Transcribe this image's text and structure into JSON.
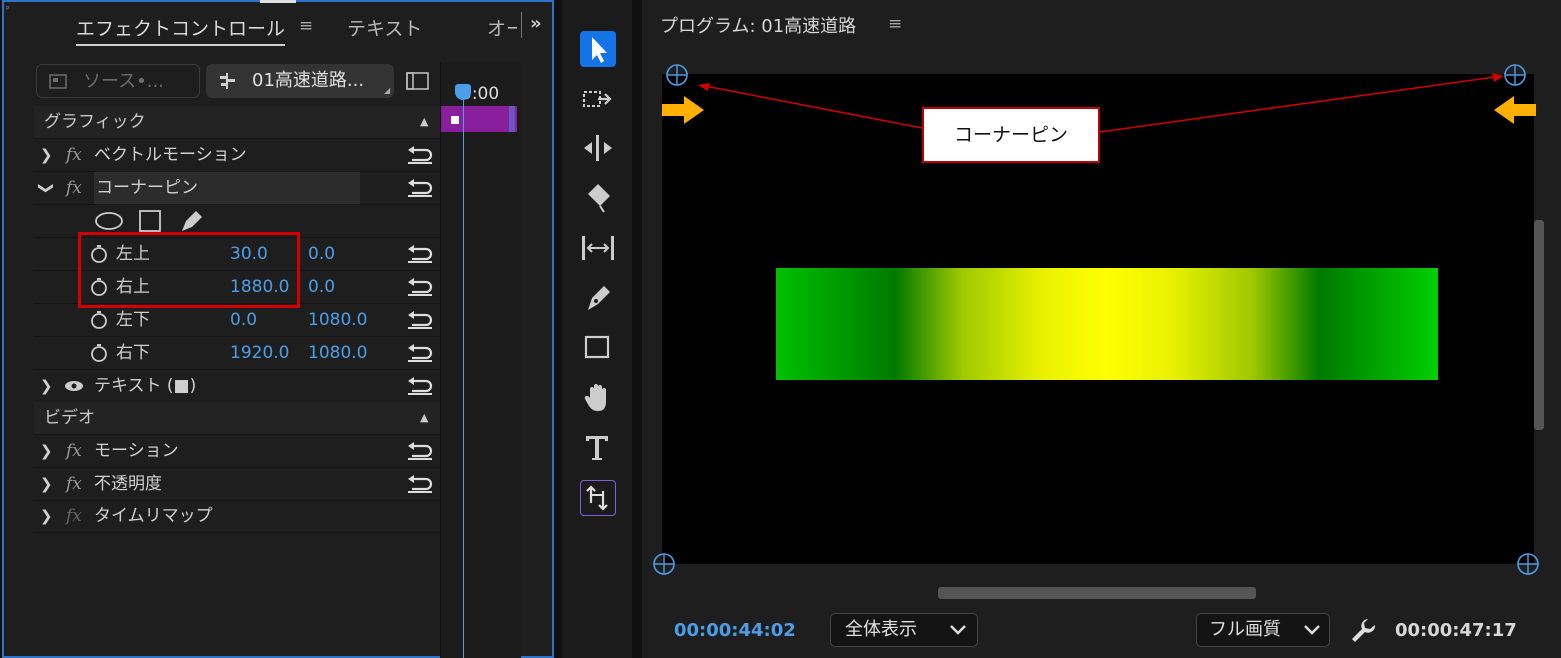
{
  "effect_panel": {
    "tabs": [
      "エフェクトコントロール",
      "テキスト",
      "オー"
    ],
    "source_label": "ソース•...",
    "clip_label": "01高速道路...",
    "timecode_small": "0:00",
    "rows": {
      "graphics": "グラフィック",
      "vector_motion": "ベクトルモーション",
      "corner_pin": "コーナーピン",
      "upper_left": {
        "label": "左上",
        "x": "30.0",
        "y": "0.0"
      },
      "upper_right": {
        "label": "右上",
        "x": "1880.0",
        "y": "0.0"
      },
      "lower_left": {
        "label": "左下",
        "x": "0.0",
        "y": "1080.0"
      },
      "lower_right": {
        "label": "右下",
        "x": "1920.0",
        "y": "1080.0"
      },
      "text_layer": "テキスト (■)",
      "video": "ビデオ",
      "motion": "モーション",
      "opacity": "不透明度",
      "time_remap": "タイムリマップ",
      "fx": "fx"
    }
  },
  "program": {
    "title": "プログラム: 01高速道路",
    "callout": "コーナーピン",
    "current_time": "00:00:44:02",
    "fit_option": "全体表示",
    "quality_option": "フル画質",
    "duration": "00:00:47:17"
  },
  "colors": {
    "accent_blue": "#4d9ee8",
    "highlight_red": "#d40000",
    "arrow_orange": "#ffb000",
    "clip_purple": "#8a1f9e"
  }
}
